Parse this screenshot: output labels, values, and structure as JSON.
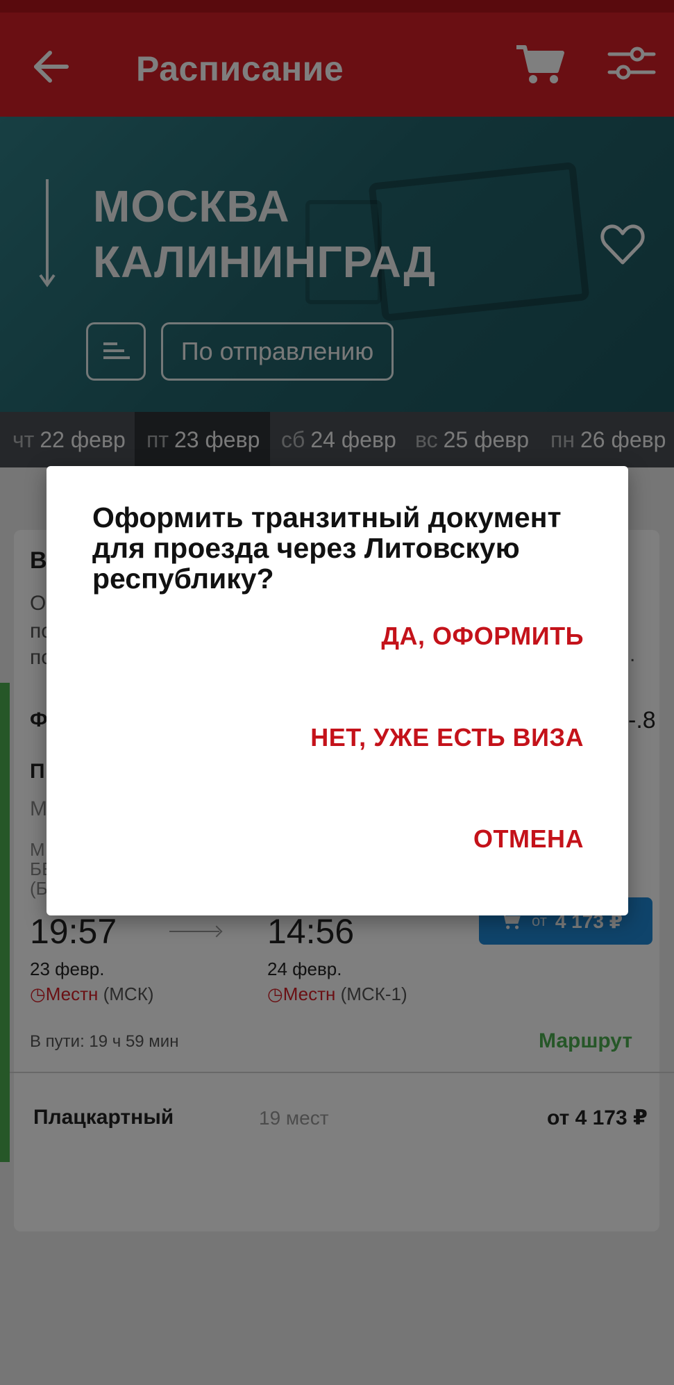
{
  "app_bar": {
    "title": "Расписание",
    "icons": {
      "back": "arrow-back-icon",
      "cart": "cart-icon",
      "filter": "filter-sliders-icon"
    },
    "color": "#d41f26"
  },
  "hero": {
    "from_city": "МОСКВА",
    "to_city": "КАЛИНИНГРАД",
    "sort_label": "По отправлению",
    "icons": {
      "favorite": "heart-icon",
      "sort": "sort-lines-icon",
      "direction": "down-arrow-icon"
    }
  },
  "dates": [
    {
      "dow": "чт",
      "date": "22 февр"
    },
    {
      "dow": "пт",
      "date": "23 февр",
      "active": true
    },
    {
      "dow": "сб",
      "date": "24 февр"
    },
    {
      "dow": "вс",
      "date": "25 февр"
    },
    {
      "dow": "пн",
      "date": "26 февр"
    }
  ],
  "background_fragments": {
    "f1": "В",
    "f2": "О",
    "f3": "по",
    "f4": "по",
    "f5": ".",
    "f6": "Ф",
    "f7": "-.8",
    "f8": "П",
    "f9": "М",
    "f10": "М",
    "f11": "БЕ",
    "f12": "(Б"
  },
  "train": {
    "departure": {
      "time": "19:57",
      "date": "23 февр.",
      "local": "Местн",
      "station": "(МСК)"
    },
    "arrival": {
      "time": "14:56",
      "date": "24 февр.",
      "local": "Местн",
      "station": "(МСК-1)"
    },
    "buy": {
      "from": "от",
      "price": "4 173 ₽"
    },
    "travel_time": "В пути: 19 ч 59 мин",
    "route_link": "Маршрут",
    "car": {
      "type": "Плацкартный",
      "seats": "19 мест",
      "price": "от 4 173 ₽"
    }
  },
  "dialog": {
    "title": "Оформить транзитный документ для проезда через Литовскую республику?",
    "confirm": "ДА, ОФОРМИТЬ",
    "has_visa": "НЕТ, УЖЕ ЕСТЬ ВИЗА",
    "cancel": "ОТМЕНА",
    "accent": "#c4121a"
  }
}
